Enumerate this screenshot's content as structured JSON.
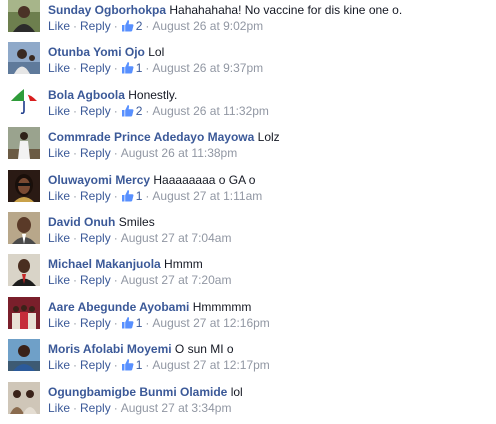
{
  "colors": {
    "link": "#3b5998",
    "meta": "#9197a3",
    "text": "#141823"
  },
  "actions": {
    "like": "Like",
    "reply": "Reply",
    "separator": "·"
  },
  "comments": [
    {
      "author": "Sunday Ogborhokpa",
      "text": "Hahahahaha! No vaccine for dis kine one o.",
      "likes": "2",
      "time": "August 26 at 9:02pm",
      "avatar": "avatar-photo"
    },
    {
      "author": "Otunba Yomi Ojo",
      "text": "Lol",
      "likes": "1",
      "time": "August 26 at 9:37pm",
      "avatar": "avatar-photo"
    },
    {
      "author": "Bola Agboola",
      "text": "Honestly.",
      "likes": "2",
      "time": "August 26 at 11:32pm",
      "avatar": "umbrella-logo-avatar"
    },
    {
      "author": "Commrade Prince Adedayo Mayowa",
      "text": "Lolz",
      "likes": "",
      "time": "August 26 at 11:38pm",
      "avatar": "avatar-photo"
    },
    {
      "author": "Oluwayomi Mercy",
      "text": "Haaaaaaaa o GA o",
      "likes": "1",
      "time": "August 27 at 1:11am",
      "avatar": "avatar-photo"
    },
    {
      "author": "David Onuh",
      "text": "Smiles",
      "likes": "",
      "time": "August 27 at 7:04am",
      "avatar": "avatar-photo"
    },
    {
      "author": "Michael Makanjuola",
      "text": "Hmmm",
      "likes": "",
      "time": "August 27 at 7:20am",
      "avatar": "avatar-photo"
    },
    {
      "author": "Aare Abegunde Ayobami",
      "text": "Hmmmmm",
      "likes": "1",
      "time": "August 27 at 12:16pm",
      "avatar": "avatar-photo"
    },
    {
      "author": "Moris Afolabi Moyemi",
      "text": "O sun MI o",
      "likes": "1",
      "time": "August 27 at 12:17pm",
      "avatar": "avatar-photo"
    },
    {
      "author": "Ogungbamigbe Bunmi Olamide",
      "text": "lol",
      "likes": "",
      "time": "August 27 at 3:34pm",
      "avatar": "avatar-photo"
    }
  ]
}
